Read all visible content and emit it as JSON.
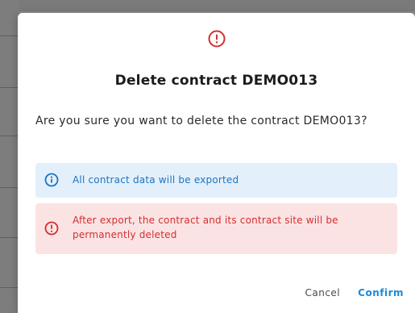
{
  "dialog": {
    "title": "Delete contract DEMO013",
    "message": "Are you sure you want to delete the contract DEMO013?",
    "icon": "warning-circle-icon",
    "icon_color": "#d32f2f"
  },
  "alerts": {
    "info": {
      "icon": "info-circle-icon",
      "text": "All contract data will be exported",
      "color": "#1b75c3",
      "background": "#e3f0fb"
    },
    "error": {
      "icon": "warning-circle-icon",
      "text": "After export, the contract and its contract site will be permanently deleted",
      "color": "#d32f2f",
      "background": "#fbe3e4"
    }
  },
  "actions": {
    "cancel_label": "Cancel",
    "confirm_label": "Confirm",
    "confirm_color": "#1b8ad8"
  }
}
